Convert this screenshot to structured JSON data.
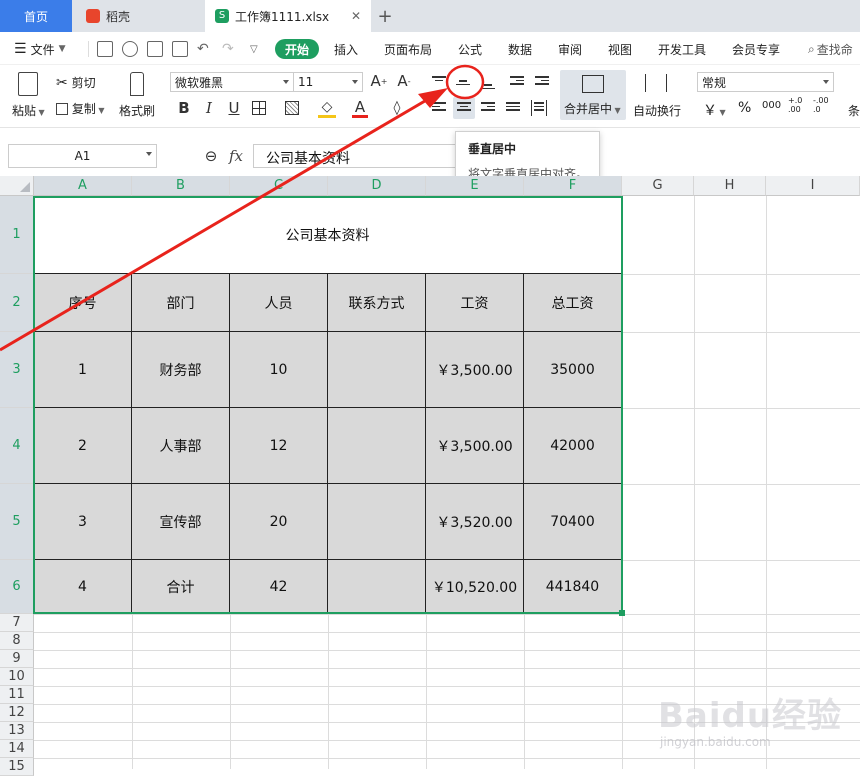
{
  "tabs": {
    "home": "首页",
    "daoke": "稻壳",
    "workbook": "工作簿1111.xlsx",
    "add": "+"
  },
  "menu": {
    "file": "文件",
    "items": [
      "开始",
      "插入",
      "页面布局",
      "公式",
      "数据",
      "审阅",
      "视图",
      "开发工具",
      "会员专享"
    ],
    "search": "查找命"
  },
  "ribbon": {
    "paste": "粘贴",
    "cut": "剪切",
    "copy": "复制",
    "format_painter": "格式刷",
    "font_name": "微软雅黑",
    "font_size": "11",
    "bold": "B",
    "italic": "I",
    "underline": "U",
    "merge_center": "合并居中",
    "wrap_text": "自动换行",
    "number_format": "常规",
    "currency": "￥",
    "percent": "%",
    "thousands": "000",
    "inc_decimal": "+.0 .00",
    "dec_decimal": "-.00 .0",
    "cond": "条"
  },
  "tooltip": {
    "title": "垂直居中",
    "desc": "将文字垂直居中对齐。"
  },
  "formula_bar": {
    "name_box": "A1",
    "fx": "fx",
    "content": "公司基本资料"
  },
  "columns": [
    "A",
    "B",
    "C",
    "D",
    "E",
    "F",
    "G",
    "H",
    "I"
  ],
  "rows": [
    "1",
    "2",
    "3",
    "4",
    "5",
    "6",
    "7",
    "8",
    "9",
    "10",
    "11",
    "12",
    "13",
    "14",
    "15"
  ],
  "table": {
    "title": "公司基本资料",
    "headers": [
      "序号",
      "部门",
      "人员",
      "联系方式",
      "工资",
      "总工资"
    ],
    "data": [
      [
        "1",
        "财务部",
        "10",
        "",
        "￥3,500.00",
        "35000"
      ],
      [
        "2",
        "人事部",
        "12",
        "",
        "￥3,500.00",
        "42000"
      ],
      [
        "3",
        "宣传部",
        "20",
        "",
        "￥3,520.00",
        "70400"
      ],
      [
        "4",
        "合计",
        "42",
        "",
        "￥10,520.00",
        "441840"
      ]
    ]
  },
  "watermark": {
    "brand": "Baidu经验",
    "url": "jingyan.baidu.com"
  },
  "colors": {
    "accent": "#1e9e60",
    "tab_active": "#3b7de9",
    "annotation": "#e8231c",
    "table_fill": "#d9d9d9"
  }
}
